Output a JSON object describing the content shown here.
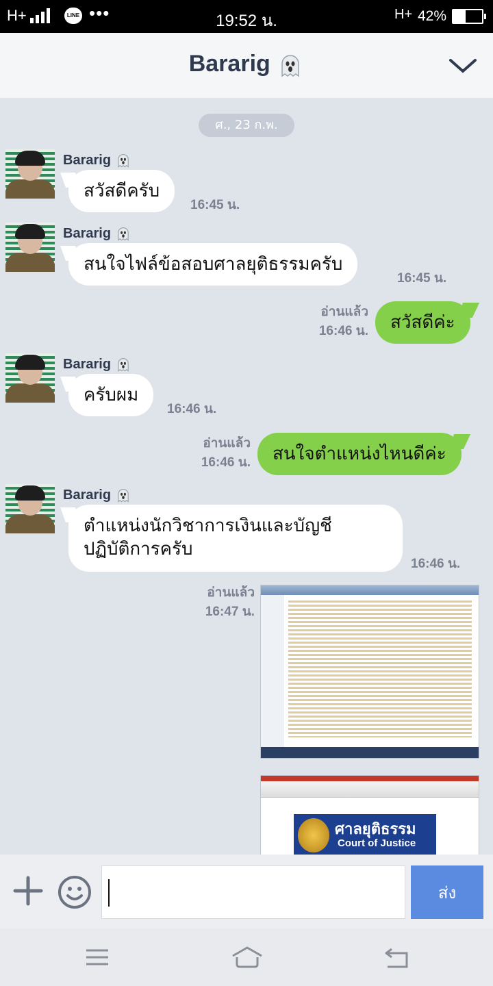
{
  "status_bar": {
    "network_left": "H+",
    "line_badge": "LINE",
    "overflow": "•••",
    "time": "19:52 น.",
    "network_right": "H+",
    "battery_percent": "42%",
    "battery_level": 0.42
  },
  "header": {
    "title": "Bararig",
    "title_icon": "ghost-icon",
    "right_icon": "chevron-down-icon"
  },
  "chat": {
    "date_label": "ศ., 23 ก.พ.",
    "messages": [
      {
        "sender": "Bararig",
        "text": "สวัสดีครับ",
        "time": "16:45 น."
      },
      {
        "sender": "Bararig",
        "text": "สนใจไฟล์ข้อสอบศาลยุติธรรมครับ",
        "time": "16:45 น."
      },
      {
        "read": "อ่านแล้ว",
        "text": "สวัสดีค่ะ",
        "time": "16:46 น."
      },
      {
        "sender": "Bararig",
        "text": "ครับผม",
        "time": "16:46 น."
      },
      {
        "read": "อ่านแล้ว",
        "text": "สนใจตำแหน่งไหนดีค่ะ",
        "time": "16:46 น."
      },
      {
        "sender": "Bararig",
        "text_line1": "ตำแหน่งนักวิชาการเงินและบัญชี",
        "text_line2": "ปฏิบัติการครับ",
        "time": "16:46 น."
      },
      {
        "read": "อ่านแล้ว",
        "time": "16:47 น.",
        "image": "file-explorer-screenshot"
      },
      {
        "image": "court-of-justice-document",
        "banner_thai": "ศาลยุติธรรม",
        "banner_en": "Court  of Justice"
      }
    ]
  },
  "input_bar": {
    "value": "",
    "send_label": "ส่ง",
    "send_color": "#5b8be0"
  },
  "colors": {
    "outgoing_bubble": "#85d04a",
    "incoming_bubble": "#ffffff",
    "chat_bg": "#dfe3ea"
  }
}
